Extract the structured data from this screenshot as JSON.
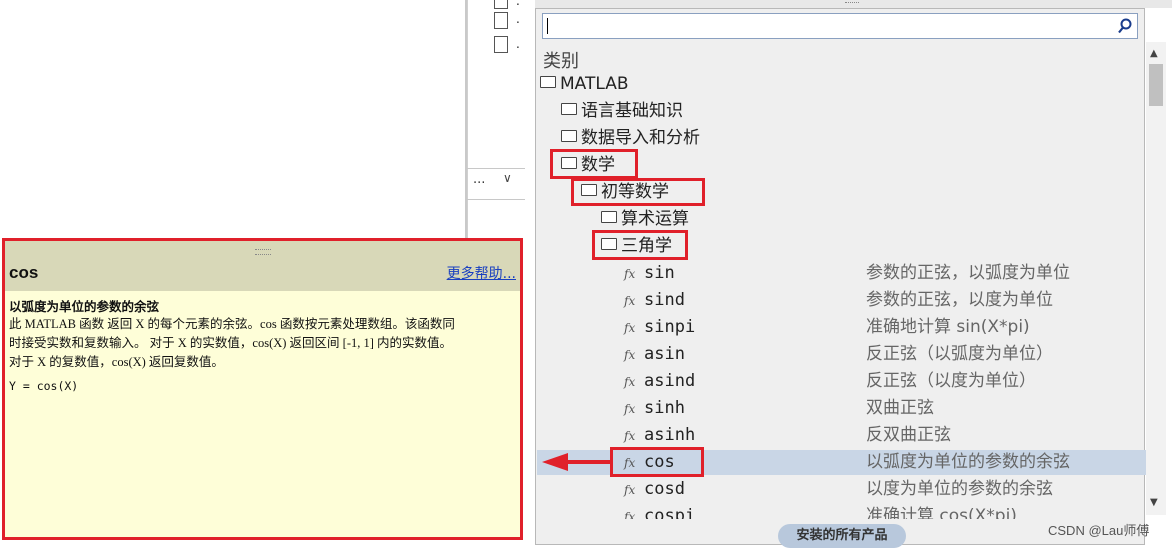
{
  "file_pane": {
    "items": [
      ".",
      ".",
      "."
    ],
    "dropdown_label": "..."
  },
  "help": {
    "title": "cos",
    "more_help": "更多帮助...",
    "summary": "以弧度为单位的参数的余弦",
    "description_lines": [
      "此 MATLAB 函数 返回 X 的每个元素的余弦。cos 函数按元素处理数组。该函数同",
      "时接受实数和复数输入。 对于 X 的实数值，cos(X) 返回区间 [-1, 1] 内的实数值。",
      "对于 X 的复数值，cos(X) 返回复数值。"
    ],
    "syntax": "Y = cos(X)"
  },
  "browser": {
    "search": {
      "value": "",
      "placeholder": ""
    },
    "category_heading": "类别",
    "folders": {
      "matlab": "MATLAB",
      "language": "语言基础知识",
      "data_import": "数据导入和分析",
      "math": "数学",
      "elementary_math": "初等数学",
      "arithmetic": "算术运算",
      "trigonometry": "三角学"
    },
    "functions": [
      {
        "name": "sin",
        "desc": "参数的正弦，以弧度为单位"
      },
      {
        "name": "sind",
        "desc": "参数的正弦，以度为单位"
      },
      {
        "name": "sinpi",
        "desc": "准确地计算 sin(X*pi)"
      },
      {
        "name": "asin",
        "desc": "反正弦（以弧度为单位）"
      },
      {
        "name": "asind",
        "desc": "反正弦（以度为单位）"
      },
      {
        "name": "sinh",
        "desc": "双曲正弦"
      },
      {
        "name": "asinh",
        "desc": "反双曲正弦"
      },
      {
        "name": "cos",
        "desc": "以弧度为单位的参数的余弦"
      },
      {
        "name": "cosd",
        "desc": "以度为单位的参数的余弦"
      },
      {
        "name": "cospi",
        "desc": "准确计算 cos(X*pi)"
      }
    ],
    "bottom_pill": "安装的所有产品"
  },
  "watermark": "CSDN @Lau师傅",
  "colors": {
    "highlight_red": "#e0202a",
    "selection": "#c9d6e6",
    "help_bg": "#fefed8",
    "link": "#1a40c0"
  }
}
